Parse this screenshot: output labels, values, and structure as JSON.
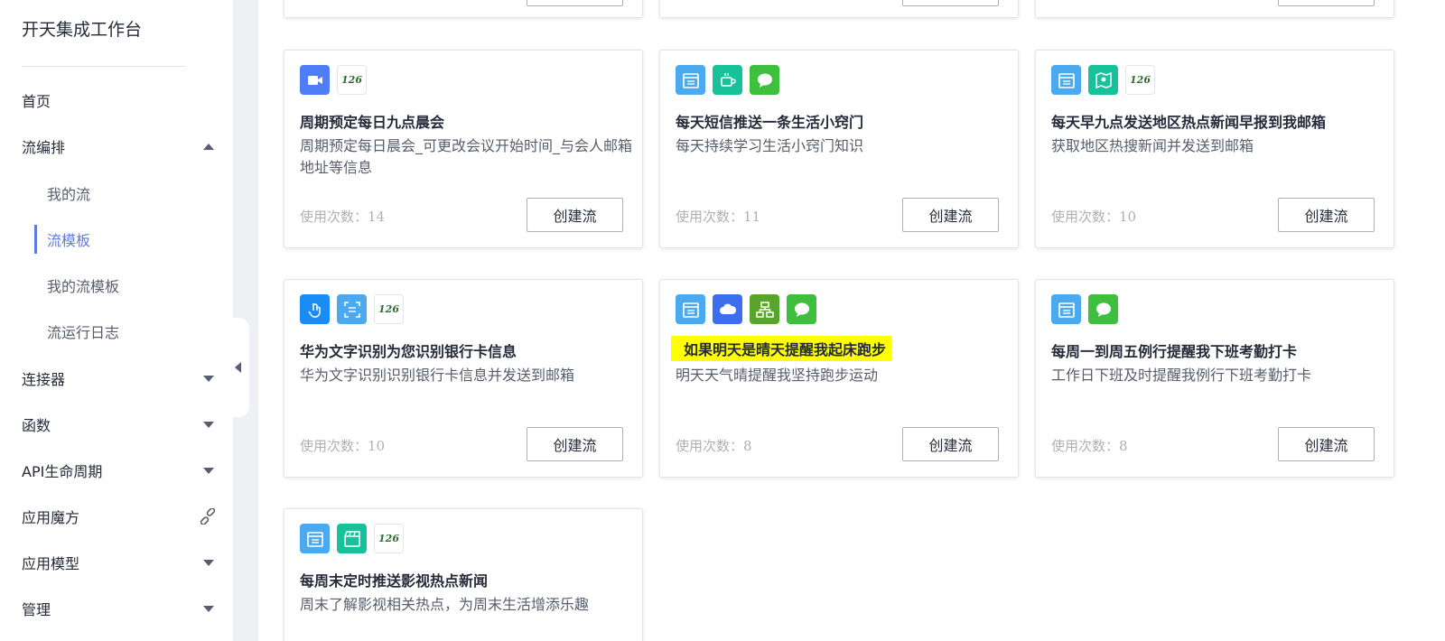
{
  "sidebar": {
    "app_title": "开天集成工作台",
    "home": "首页",
    "flow_orchestration": "流编排",
    "my_flows": "我的流",
    "flow_templates": "流模板",
    "my_flow_templates": "我的流模板",
    "flow_logs": "流运行日志",
    "connectors": "连接器",
    "functions": "函数",
    "api_lifecycle": "API生命周期",
    "app_cube": "应用魔方",
    "app_models": "应用模型",
    "management": "管理"
  },
  "usage_label": "使用次数：",
  "create_label": "创建流",
  "cards": [
    {
      "title": "周期预定每日九点晨会",
      "desc": "周期预定每日晨会_可更改会议开始时间_与会人邮箱地址等信息",
      "usage": "14",
      "icons": [
        "video-camera-icon",
        "mail-126-icon"
      ]
    },
    {
      "title": "每天短信推送一条生活小窍门",
      "desc": "每天持续学习生活小窍门知识",
      "usage": "11",
      "icons": [
        "calendar-schedule-icon",
        "tea-cup-icon",
        "chat-bubble-icon"
      ]
    },
    {
      "title": "每天早九点发送地区热点新闻早报到我邮箱",
      "desc": "获取地区热搜新闻并发送到邮箱",
      "usage": "10",
      "icons": [
        "calendar-schedule-icon",
        "map-news-icon",
        "mail-126-icon"
      ]
    },
    {
      "title": "华为文字识别为您识别银行卡信息",
      "desc": "华为文字识别识别银行卡信息并发送到邮箱",
      "usage": "10",
      "icons": [
        "touch-hand-icon",
        "text-scan-icon",
        "mail-126-icon"
      ]
    },
    {
      "title": "如果明天是晴天提醒我起床跑步",
      "desc": "明天天气晴提醒我坚持跑步运动",
      "usage": "8",
      "icons": [
        "calendar-schedule-icon",
        "cloud-icon",
        "flowchart-icon",
        "chat-bubble-icon"
      ]
    },
    {
      "title": "每周一到周五例行提醒我下班考勤打卡",
      "desc": "工作日下班及时提醒我例行下班考勤打卡",
      "usage": "8",
      "icons": [
        "calendar-schedule-icon",
        "chat-bubble-icon"
      ]
    },
    {
      "title": "每周末定时推送影视热点新闻",
      "desc": "周末了解影视相关热点，为周末生活增添乐趣",
      "usage": "",
      "icons": [
        "calendar-schedule-icon",
        "clapperboard-icon",
        "mail-126-icon"
      ]
    }
  ],
  "icon_text_126": "126",
  "colors": {
    "accent": "#5e7ce0",
    "highlight": "#ffff00",
    "blue_icon": "#4ba9f0",
    "green_icon": "#3ebf3e",
    "teal_icon": "#17c29a"
  }
}
